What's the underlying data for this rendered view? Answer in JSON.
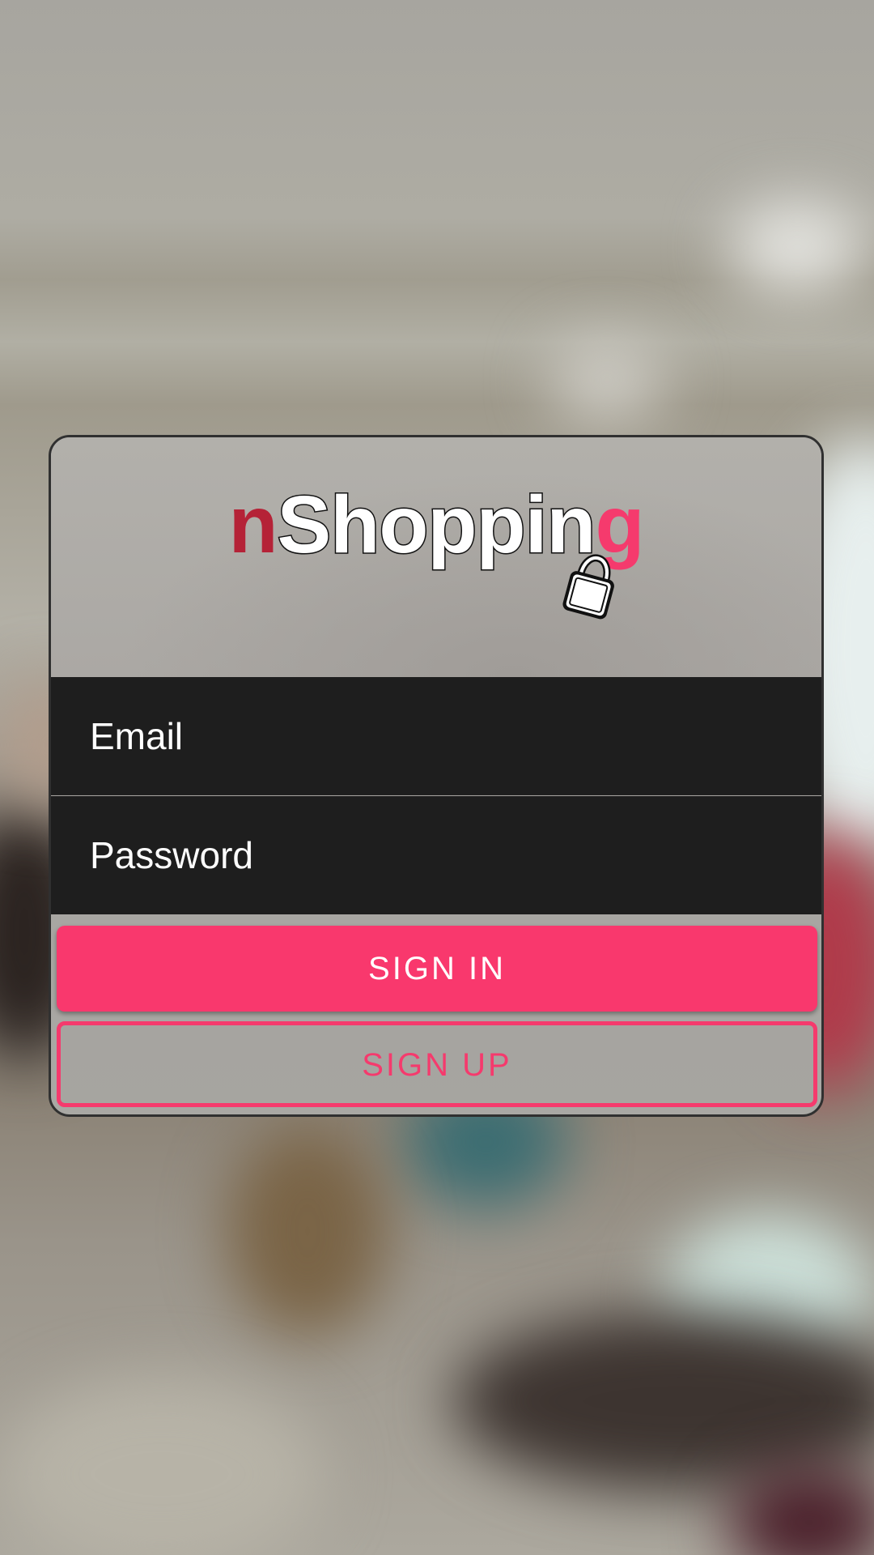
{
  "logo": {
    "prefix": "n",
    "main": "Shoppin",
    "suffix": "g",
    "icon": "shopping-bag-icon"
  },
  "form": {
    "email_placeholder": "Email",
    "password_placeholder": "Password"
  },
  "buttons": {
    "sign_in": "SIGN IN",
    "sign_up": "SIGN UP"
  },
  "colors": {
    "accent": "#f9386d",
    "logo_prefix": "#b52237",
    "field_background": "#1e1e1e"
  }
}
